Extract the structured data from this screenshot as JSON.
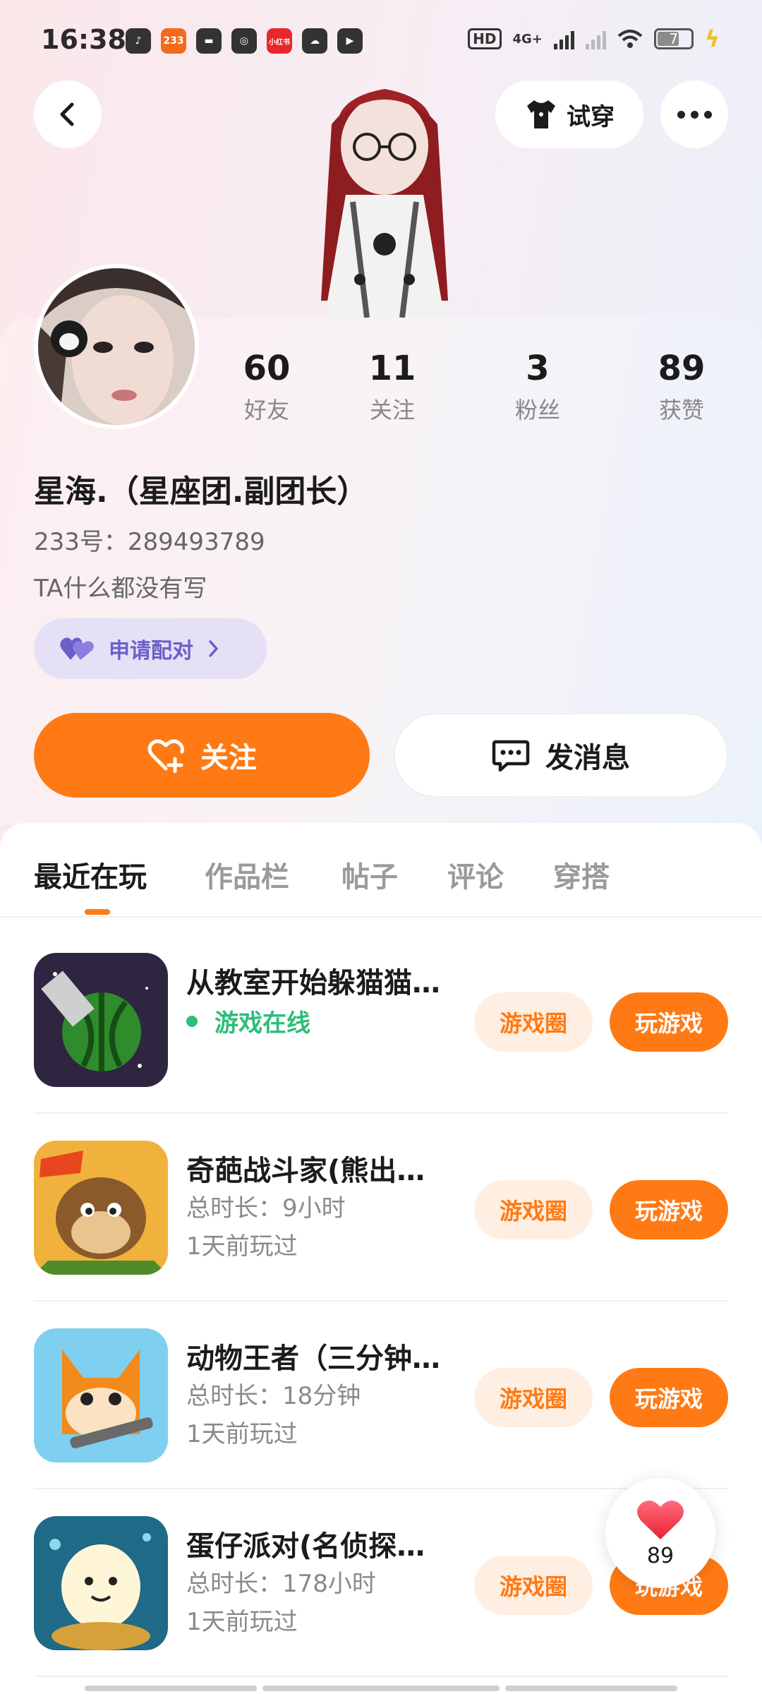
{
  "status_bar": {
    "time": "16:38",
    "apps": [
      "tiktok",
      "233",
      "inbox",
      "planet",
      "小红书",
      "wechat",
      "player"
    ],
    "app_labels": {
      "a233": "233",
      "xhs": "小红书"
    },
    "network": "4G+",
    "hd": "HD",
    "battery": "7"
  },
  "top_actions": {
    "try_on_label": "试穿"
  },
  "profile": {
    "stats": [
      {
        "value": "60",
        "label": "好友"
      },
      {
        "value": "11",
        "label": "关注"
      },
      {
        "value": "3",
        "label": "粉丝"
      },
      {
        "value": "89",
        "label": "获赞"
      }
    ],
    "nickname": "星海.（星座团.副团长）",
    "uid_label": "233号：",
    "uid": "289493789",
    "bio": "TA什么都没有写",
    "pair_label": "申请配对",
    "follow_label": "关注",
    "message_label": "发消息"
  },
  "tabs": [
    "最近在玩",
    "作品栏",
    "帖子",
    "评论",
    "穿搭"
  ],
  "games": [
    {
      "title": "从教室开始躲猫猫…",
      "status": "游戏在线",
      "circle_label": "游戏圈",
      "play_label": "玩游戏"
    },
    {
      "title": "奇葩战斗家(熊出…",
      "duration": "总时长：9小时",
      "last_played": "1天前玩过",
      "circle_label": "游戏圈",
      "play_label": "玩游戏"
    },
    {
      "title": "动物王者（三分钟…",
      "duration": "总时长：18分钟",
      "last_played": "1天前玩过",
      "circle_label": "游戏圈",
      "play_label": "玩游戏"
    },
    {
      "title": "蛋仔派对(名侦探…",
      "duration": "总时长：178小时",
      "last_played": "1天前玩过",
      "circle_label": "游戏圈",
      "play_label": "玩游戏"
    }
  ],
  "like_float": {
    "count": "89"
  },
  "colors": {
    "accent": "#ff7a14",
    "online": "#2ebd7b",
    "pair": "#6a5fc8"
  }
}
